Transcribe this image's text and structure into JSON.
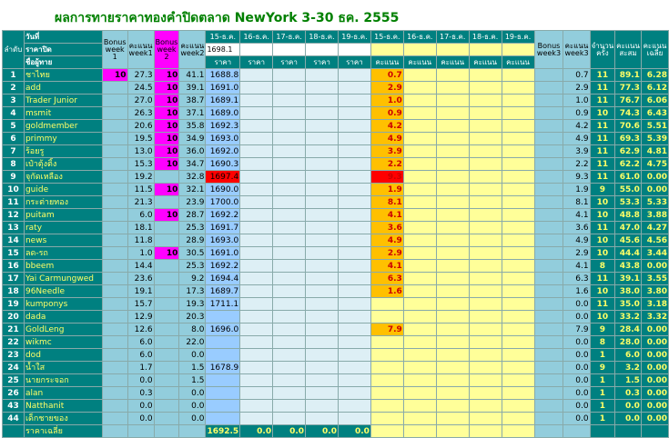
{
  "title": "ผลการทายราคาทองคำปิดตลาด NewYork 3-30 ธค. 2555",
  "headers": {
    "rank": "ลำดับ",
    "date_label": "วันที่",
    "close_price_label": "ราคาปิด",
    "predictor_label": "ชื่อผู้ทาย",
    "bonus_week1": "Bonus week 1",
    "score_week1": "คะแนน week1",
    "bonus_week2": "Bonus week 2",
    "score_week2": "คะแนน week2",
    "price_dates": [
      "15-ธ.ค.",
      "16-ธ.ค.",
      "17-ธ.ค.",
      "18-ธ.ค.",
      "19-ธ.ค."
    ],
    "close_price_value": "1698.1",
    "price_sub": "ราคา",
    "score_dates": [
      "15-ธ.ค.",
      "16-ธ.ค.",
      "17-ธ.ค.",
      "18-ธ.ค.",
      "19-ธ.ค."
    ],
    "score_sub": "คะแนน",
    "bonus_week3": "Bonus week3",
    "score_week3": "คะแนน week3",
    "count": "จำนวนครั้ง",
    "total_score": "คะแนนสะสม",
    "avg_score": "คะแนนเฉลี่ย"
  },
  "rows": [
    {
      "rank": "1",
      "name": "ชาไทย",
      "bonus1": "10",
      "w1": "27.3",
      "bonus2": "10",
      "w2": "41.1",
      "price": "1688.8",
      "score": "0.7",
      "w3": "0.7",
      "count": "11",
      "total": "89.1",
      "avg": "6.28"
    },
    {
      "rank": "2",
      "name": "add",
      "bonus1": "",
      "w1": "24.5",
      "bonus2": "10",
      "w2": "39.1",
      "price": "1691.0",
      "score": "2.9",
      "w3": "2.9",
      "count": "11",
      "total": "77.3",
      "avg": "6.12"
    },
    {
      "rank": "3",
      "name": "Trader Junior",
      "bonus1": "",
      "w1": "27.0",
      "bonus2": "10",
      "w2": "38.7",
      "price": "1689.1",
      "score": "1.0",
      "w3": "1.0",
      "count": "11",
      "total": "76.7",
      "avg": "6.06"
    },
    {
      "rank": "4",
      "name": "msmit",
      "bonus1": "",
      "w1": "26.3",
      "bonus2": "10",
      "w2": "37.1",
      "price": "1689.0",
      "score": "0.9",
      "w3": "0.9",
      "count": "10",
      "total": "74.3",
      "avg": "6.43"
    },
    {
      "rank": "5",
      "name": "goldmember",
      "bonus1": "",
      "w1": "20.6",
      "bonus2": "10",
      "w2": "35.8",
      "price": "1692.3",
      "score": "4.2",
      "w3": "4.2",
      "count": "11",
      "total": "70.6",
      "avg": "5.51"
    },
    {
      "rank": "6",
      "name": "primmy",
      "bonus1": "",
      "w1": "19.5",
      "bonus2": "10",
      "w2": "34.9",
      "price": "1693.0",
      "score": "4.9",
      "w3": "4.9",
      "count": "11",
      "total": "69.3",
      "avg": "5.39"
    },
    {
      "rank": "7",
      "name": "ร้อยรู",
      "bonus1": "",
      "w1": "13.0",
      "bonus2": "10",
      "w2": "36.0",
      "price": "1692.0",
      "score": "3.9",
      "w3": "3.9",
      "count": "11",
      "total": "62.9",
      "avg": "4.81"
    },
    {
      "rank": "8",
      "name": "เป๋าตุ้งติ้ง",
      "bonus1": "",
      "w1": "15.3",
      "bonus2": "10",
      "w2": "34.7",
      "price": "1690.3",
      "score": "2.2",
      "w3": "2.2",
      "count": "11",
      "total": "62.2",
      "avg": "4.75"
    },
    {
      "rank": "9",
      "name": "จุกัดเหลือง",
      "bonus1": "",
      "w1": "19.2",
      "bonus2": "",
      "w2": "32.8",
      "price": "1697.4",
      "score": "9.3",
      "w3": "9.3",
      "count": "11",
      "total": "61.0",
      "avg": "0.00"
    },
    {
      "rank": "10",
      "name": "guide",
      "bonus1": "",
      "w1": "11.5",
      "bonus2": "10",
      "w2": "32.1",
      "price": "1690.0",
      "score": "1.9",
      "w3": "1.9",
      "count": "9",
      "total": "55.0",
      "avg": "0.00"
    },
    {
      "rank": "11",
      "name": "กระต่ายทอง",
      "bonus1": "",
      "w1": "21.3",
      "bonus2": "",
      "w2": "23.9",
      "price": "1700.0",
      "score": "8.1",
      "w3": "8.1",
      "count": "10",
      "total": "53.3",
      "avg": "5.33"
    },
    {
      "rank": "12",
      "name": "puitam",
      "bonus1": "",
      "w1": "6.0",
      "bonus2": "10",
      "w2": "28.7",
      "price": "1692.2",
      "score": "4.1",
      "w3": "4.1",
      "count": "10",
      "total": "48.8",
      "avg": "3.88"
    },
    {
      "rank": "13",
      "name": "raty",
      "bonus1": "",
      "w1": "18.1",
      "bonus2": "",
      "w2": "25.3",
      "price": "1691.7",
      "score": "3.6",
      "w3": "3.6",
      "count": "11",
      "total": "47.0",
      "avg": "4.27"
    },
    {
      "rank": "14",
      "name": "news",
      "bonus1": "",
      "w1": "11.8",
      "bonus2": "",
      "w2": "28.9",
      "price": "1693.0",
      "score": "4.9",
      "w3": "4.9",
      "count": "10",
      "total": "45.6",
      "avg": "4.56"
    },
    {
      "rank": "15",
      "name": "ลด-รถ",
      "bonus1": "",
      "w1": "1.0",
      "bonus2": "10",
      "w2": "30.5",
      "price": "1691.0",
      "score": "2.9",
      "w3": "2.9",
      "count": "10",
      "total": "44.4",
      "avg": "3.44"
    },
    {
      "rank": "16",
      "name": "bbeem",
      "bonus1": "",
      "w1": "14.4",
      "bonus2": "",
      "w2": "25.3",
      "price": "1692.2",
      "score": "4.1",
      "w3": "4.1",
      "count": "8",
      "total": "43.8",
      "avg": "0.00"
    },
    {
      "rank": "17",
      "name": "Yai Carmungwed",
      "bonus1": "",
      "w1": "23.6",
      "bonus2": "",
      "w2": "9.2",
      "price": "1694.4",
      "score": "6.3",
      "w3": "6.3",
      "count": "11",
      "total": "39.1",
      "avg": "3.55"
    },
    {
      "rank": "18",
      "name": "96Needle",
      "bonus1": "",
      "w1": "19.1",
      "bonus2": "",
      "w2": "17.3",
      "price": "1689.7",
      "score": "1.6",
      "w3": "1.6",
      "count": "10",
      "total": "38.0",
      "avg": "3.80"
    },
    {
      "rank": "19",
      "name": "kumponys",
      "bonus1": "",
      "w1": "15.7",
      "bonus2": "",
      "w2": "19.3",
      "price": "1711.1",
      "score": "",
      "w3": "0.0",
      "count": "11",
      "total": "35.0",
      "avg": "3.18"
    },
    {
      "rank": "20",
      "name": "dada",
      "bonus1": "",
      "w1": "12.9",
      "bonus2": "",
      "w2": "20.3",
      "price": "",
      "score": "",
      "w3": "0.0",
      "count": "10",
      "total": "33.2",
      "avg": "3.32"
    },
    {
      "rank": "21",
      "name": "GoldLeng",
      "bonus1": "",
      "w1": "12.6",
      "bonus2": "",
      "w2": "8.0",
      "price": "1696.0",
      "score": "7.9",
      "w3": "7.9",
      "count": "9",
      "total": "28.4",
      "avg": "0.00"
    },
    {
      "rank": "22",
      "name": "wikmc",
      "bonus1": "",
      "w1": "6.0",
      "bonus2": "",
      "w2": "22.0",
      "price": "",
      "score": "",
      "w3": "0.0",
      "count": "8",
      "total": "28.0",
      "avg": "0.00"
    },
    {
      "rank": "23",
      "name": "dod",
      "bonus1": "",
      "w1": "6.0",
      "bonus2": "",
      "w2": "0.0",
      "price": "",
      "score": "",
      "w3": "0.0",
      "count": "1",
      "total": "6.0",
      "avg": "0.00"
    },
    {
      "rank": "24",
      "name": "น้ำใส",
      "bonus1": "",
      "w1": "1.7",
      "bonus2": "",
      "w2": "1.5",
      "price": "1678.9",
      "score": "",
      "w3": "0.0",
      "count": "9",
      "total": "3.2",
      "avg": "0.00"
    },
    {
      "rank": "25",
      "name": "นายกระจอก",
      "bonus1": "",
      "w1": "0.0",
      "bonus2": "",
      "w2": "1.5",
      "price": "",
      "score": "",
      "w3": "0.0",
      "count": "1",
      "total": "1.5",
      "avg": "0.00"
    },
    {
      "rank": "26",
      "name": "alan",
      "bonus1": "",
      "w1": "0.3",
      "bonus2": "",
      "w2": "0.0",
      "price": "",
      "score": "",
      "w3": "0.0",
      "count": "1",
      "total": "0.3",
      "avg": "0.00"
    },
    {
      "rank": "43",
      "name": "Natthanit",
      "bonus1": "",
      "w1": "0.0",
      "bonus2": "",
      "w2": "0.0",
      "price": "",
      "score": "",
      "w3": "0.0",
      "count": "1",
      "total": "0.0",
      "avg": "0.00"
    },
    {
      "rank": "44",
      "name": "เด็กชายของ",
      "bonus1": "",
      "w1": "0.0",
      "bonus2": "",
      "w2": "0.0",
      "price": "",
      "score": "",
      "w3": "0.0",
      "count": "1",
      "total": "0.0",
      "avg": "0.00"
    }
  ],
  "footer": {
    "label": "ราคาเฉลี่ย",
    "price_avg": "1692.5",
    "other_avgs": [
      "0.0",
      "0.0",
      "0.0",
      "0.0"
    ]
  },
  "colors": {
    "teal": "#008080",
    "yellow_text": "#ffff66",
    "magenta": "#ff00ff",
    "cornflower": "#99ccff",
    "orange": "#ffc000",
    "red": "#ff0000",
    "pale_yellow": "#ffff99",
    "pale_blue": "#ddeff5",
    "title_green": "#008000"
  }
}
